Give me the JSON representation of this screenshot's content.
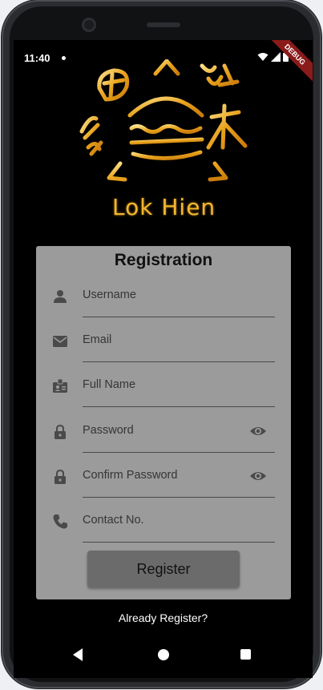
{
  "status_bar": {
    "time": "11:40",
    "debug_label": "DEBUG"
  },
  "logo": {
    "text": "Lok Hien",
    "accent_color": "#f2b62e"
  },
  "form": {
    "title": "Registration",
    "fields": [
      {
        "label": "Username",
        "icon": "person-icon"
      },
      {
        "label": "Email",
        "icon": "email-icon"
      },
      {
        "label": "Full Name",
        "icon": "badge-icon"
      },
      {
        "label": "Password",
        "icon": "lock-icon",
        "visibility_toggle": "eye-icon"
      },
      {
        "label": "Confirm Password",
        "icon": "lock-icon",
        "visibility_toggle": "eye-icon"
      },
      {
        "label": "Contact No.",
        "icon": "phone-icon"
      }
    ],
    "submit_label": "Register"
  },
  "footer": {
    "already_registered_link": "Already Register?"
  },
  "colors": {
    "card_bg": "#9b9b9b",
    "button_bg": "#6b6b6b",
    "screen_bg": "#000000"
  }
}
